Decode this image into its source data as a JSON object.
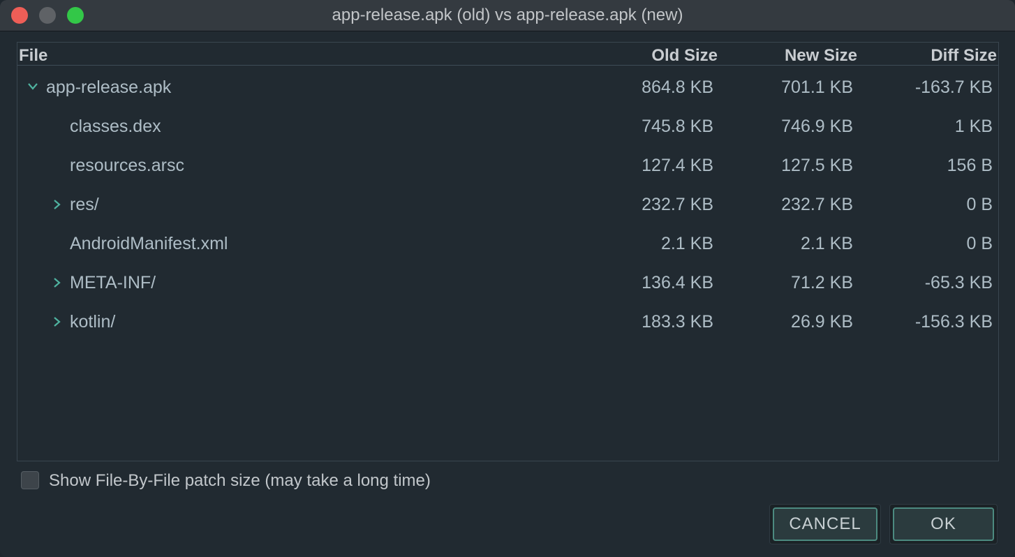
{
  "window": {
    "title": "app-release.apk (old) vs app-release.apk (new)"
  },
  "columns": {
    "file": "File",
    "old_size": "Old Size",
    "new_size": "New Size",
    "diff_size": "Diff Size"
  },
  "rows": [
    {
      "name": "app-release.apk",
      "old": "864.8 KB",
      "new": "701.1 KB",
      "diff": "-163.7 KB",
      "expander": "expanded"
    },
    {
      "name": "classes.dex",
      "old": "745.8 KB",
      "new": "746.9 KB",
      "diff": "1 KB",
      "expander": "none"
    },
    {
      "name": "resources.arsc",
      "old": "127.4 KB",
      "new": "127.5 KB",
      "diff": "156 B",
      "expander": "none"
    },
    {
      "name": "res/",
      "old": "232.7 KB",
      "new": "232.7 KB",
      "diff": "0 B",
      "expander": "collapsed"
    },
    {
      "name": "AndroidManifest.xml",
      "old": "2.1 KB",
      "new": "2.1 KB",
      "diff": "0 B",
      "expander": "none"
    },
    {
      "name": "META-INF/",
      "old": "136.4 KB",
      "new": "71.2 KB",
      "diff": "-65.3 KB",
      "expander": "collapsed"
    },
    {
      "name": "kotlin/",
      "old": "183.3 KB",
      "new": "26.9 KB",
      "diff": "-156.3 KB",
      "expander": "collapsed"
    }
  ],
  "options": {
    "file_by_file_label": "Show File-By-File patch size (may take a long time)",
    "file_by_file_checked": false
  },
  "buttons": {
    "cancel": "CANCEL",
    "ok": "OK"
  },
  "colors": {
    "accent": "#4fb3a0",
    "close": "#ee5e57",
    "minimize": "#5f6266",
    "maximize": "#33c748"
  }
}
